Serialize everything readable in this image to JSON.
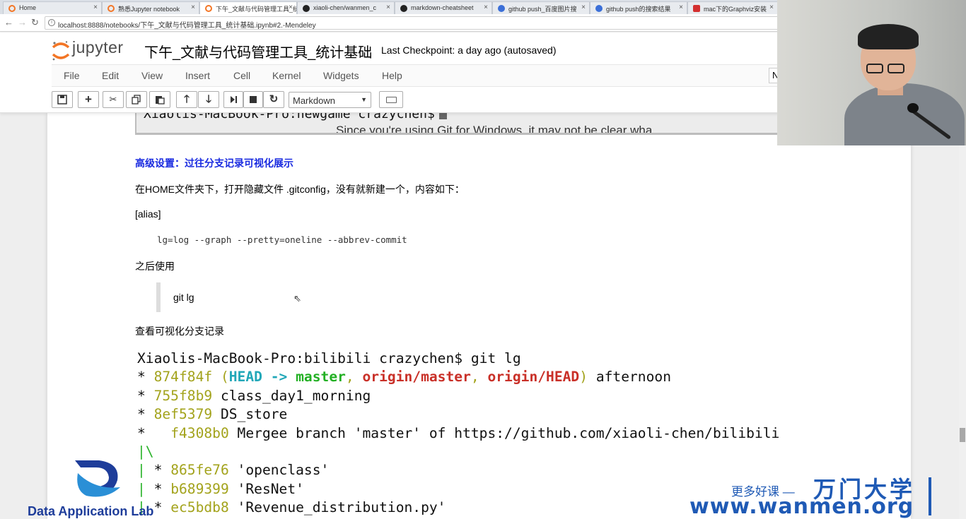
{
  "browser": {
    "tabs": [
      {
        "title": "Home",
        "icon_color": "#f37626"
      },
      {
        "title": "熟悉Jupyter notebook",
        "icon_color": "#f37626"
      },
      {
        "title": "下午_文献与代码管理工具_统计基础",
        "icon_color": "#f37626"
      },
      {
        "title": "xiaoli-chen/wanmen_c",
        "icon_color": "#222222"
      },
      {
        "title": "markdown-cheatsheet",
        "icon_color": "#222222"
      },
      {
        "title": "github push_百度图片搜",
        "icon_color": "#3b6fd8"
      },
      {
        "title": "github push的搜索结果",
        "icon_color": "#3b6fd8"
      },
      {
        "title": "mac下的Graphviz安装",
        "icon_color": "#d32f2f"
      }
    ],
    "url": "localhost:8888/notebooks/下午_文献与代码管理工具_统计基础.ipynb#2.-Mendeley"
  },
  "jupyter": {
    "logo_text": "jupyter",
    "notebook_title": "下午_文献与代码管理工具_统计基础",
    "checkpoint": "Last Checkpoint: a day ago (autosaved)",
    "menu": [
      "File",
      "Edit",
      "View",
      "Insert",
      "Cell",
      "Kernel",
      "Widgets",
      "Help"
    ],
    "cell_type": "Markdown",
    "notif_letter": "N"
  },
  "notebook": {
    "top_terminal_line": "Xiaolis-MacBook-Pro:newgame crazychen$",
    "top_terminal_bg_text": "Since you're using Git for Windows, it may not be clear wha",
    "heading": "高级设置：过往分支记录可视化展示",
    "para1": "在HOME文件夹下，打开隐藏文件 .gitconfig，没有就新建一个，内容如下：",
    "para2": "[alias]",
    "code_line": "lg=log --graph --pretty=oneline --abbrev-commit",
    "para3": "之后使用",
    "quote_text": "git lg",
    "para4": "查看可视化分支记录"
  },
  "gitlog": {
    "prompt": "Xiaolis-MacBook-Pro:bilibili crazychen$ git lg",
    "line1": {
      "star": "* ",
      "hash": "874f84f",
      "open": " (",
      "head": "HEAD -> ",
      "master": "master",
      "sep1": ", ",
      "origin_master": "origin/master",
      "sep2": ", ",
      "origin_head": "origin/HEAD",
      "close": ")",
      "msg": " afternoon"
    },
    "line2": {
      "star": "* ",
      "hash": "755f8b9",
      "msg": " class_day1_morning"
    },
    "line3": {
      "star": "* ",
      "hash": "8ef5379",
      "msg": " DS_store"
    },
    "line4": {
      "star": "*   ",
      "hash": "f4308b0",
      "msg": " Mergee branch 'master' of https://github.com/xiaoli-chen/bilibili"
    },
    "line5": {
      "graph": "|\\"
    },
    "line6": {
      "bar": "| ",
      "star": "* ",
      "hash": "865fe76",
      "msg": " 'openclass'"
    },
    "line7": {
      "bar": "| ",
      "star": "* ",
      "hash": "b689399",
      "msg": " 'ResNet'"
    },
    "line8": {
      "bar": "| ",
      "star": "* ",
      "hash": "ec5bdb8",
      "msg": " 'Revenue_distribution.py'"
    }
  },
  "watermark": {
    "lab_name": "Data Application Lab",
    "slogan": "更多好课 —",
    "brand": "万门大学",
    "url": "www.wanmen.org"
  },
  "colors": {
    "heading_blue": "#1a2be0",
    "brand_blue": "#1f5ab5",
    "jupyter_orange": "#f37626"
  }
}
